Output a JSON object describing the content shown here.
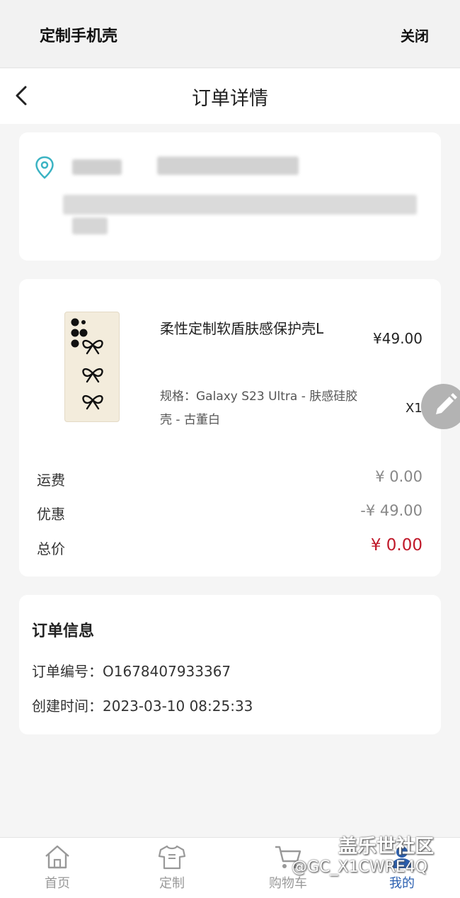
{
  "miniapp": {
    "title": "定制手机壳",
    "close_label": "关闭"
  },
  "nav": {
    "title": "订单详情"
  },
  "product": {
    "name": "柔性定制软盾肤感保护壳L",
    "price": "¥49.00",
    "spec": "规格：Galaxy S23 Ultra - 肤感硅胶壳 - 古董白",
    "quantity": "X1"
  },
  "costs": {
    "shipping_label": "运费",
    "shipping_value": "¥ 0.00",
    "discount_label": "优惠",
    "discount_value": "-¥ 49.00",
    "total_label": "总价",
    "total_value": "¥ 0.00"
  },
  "order_info": {
    "title": "订单信息",
    "number_line": "订单编号：O1678407933367",
    "created_line": "创建时间：2023-03-10 08:25:33"
  },
  "tabbar": {
    "items": [
      {
        "label": "首页",
        "icon": "home-icon"
      },
      {
        "label": "定制",
        "icon": "tshirt-icon"
      },
      {
        "label": "购物车",
        "icon": "cart-icon"
      },
      {
        "label": "我的",
        "icon": "user-icon"
      }
    ],
    "active_index": 3
  },
  "watermark": {
    "title": "盖乐世社区",
    "user": "@GC_X1CWRE4Q"
  },
  "colors": {
    "accent": "#2a5fb0",
    "price_red": "#c0192a",
    "location_icon": "#3bb3c3",
    "background": "#f5f5f5"
  }
}
